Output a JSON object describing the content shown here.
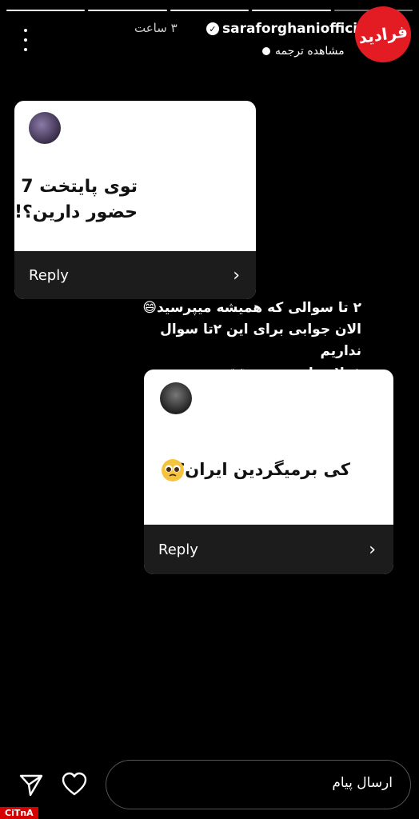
{
  "header": {
    "username": "saraforghaniofficial",
    "time_ago": "۳ ساعت",
    "translate_label": "مشاهده ترجمه",
    "logo_text": "فرادید"
  },
  "story": {
    "progress_segments": 5,
    "progress_done": 4,
    "question1": {
      "text_line1": "توی پایتخت 7",
      "text_line2": "حضور دارین؟!",
      "reply_label": "Reply"
    },
    "caption": {
      "line1": "۲ تا سوالی که همیشه میپرسید😄",
      "line2": "الان جوابی برای این ۲تا سوال نداریم",
      "line3": "فعلا معلوم نیست👐"
    },
    "question2": {
      "text": "کی برمیگردین ایران؟",
      "reply_label": "Reply"
    }
  },
  "footer": {
    "message_placeholder": "ارسال پیام",
    "watermark": "CiTnA"
  }
}
